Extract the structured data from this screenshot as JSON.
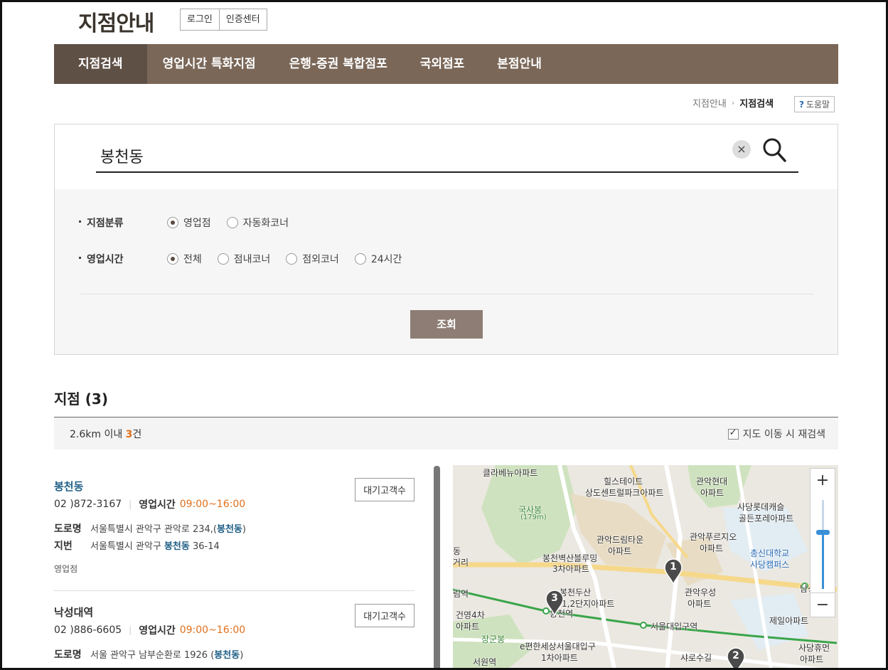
{
  "header": {
    "title": "지점안내",
    "login_label": "로그인",
    "cert_label": "인증센터"
  },
  "nav": {
    "items": [
      "지점검색",
      "영업시간 특화지점",
      "은행-증권 복합점포",
      "국외점포",
      "본점안내"
    ]
  },
  "breadcrumb": {
    "parent": "지점안내",
    "current": "지점검색",
    "help_q": "?",
    "help_label": "도움말"
  },
  "search": {
    "value": "봉천동",
    "clear_symbol": "×"
  },
  "filters": {
    "type_label": "지점분류",
    "type_options": [
      "영업점",
      "자동화코너"
    ],
    "type_selected": "영업점",
    "hours_label": "영업시간",
    "hours_options": [
      "전체",
      "점내코너",
      "점외코너",
      "24시간"
    ],
    "hours_selected": "전체",
    "submit_label": "조회"
  },
  "results": {
    "title": "지점 (3)",
    "radius": "2.6km 이내 ",
    "count": "3",
    "count_suffix": "건",
    "map_research_label": "지도 이동 시 재검색",
    "map_research_checked": true,
    "branches": [
      {
        "name": "봉천동",
        "phone": "02 )872-3167",
        "hours_label": "영업시간",
        "hours": "09:00~16:00",
        "road_label": "도로명",
        "road_addr": "서울특별시 관악구 관악로 234,(",
        "road_kw": "봉천동",
        "road_end": ")",
        "lot_label": "지번",
        "lot_addr": "서울특별시 관악구 ",
        "lot_kw": "봉천동",
        "lot_end": " 36-14",
        "type": "영업점",
        "wait_label": "대기고객수"
      },
      {
        "name": "낙성대역",
        "phone": "02 )886-6605",
        "hours_label": "영업시간",
        "hours": "09:00~16:00",
        "road_label": "도로명",
        "road_addr": "서울 관악구 남부순환로 1926 (",
        "road_kw": "봉천동",
        "road_end": ")",
        "wait_label": "대기고객수"
      }
    ]
  },
  "map": {
    "zoom_in": "+",
    "zoom_out": "−",
    "labels": [
      "클라베뉴아파트",
      "힐스테이트",
      "상도센트럴파크아파트",
      "관악현대",
      "아파트",
      "국사봉",
      "(179m)",
      "사당롯데캐슬",
      "골든포레아파트",
      "관악드림타운",
      "아파트",
      "관악푸르지오",
      "아파트",
      "총신대학교",
      "사당캠퍼스",
      "봉천벽산블루밍",
      "3차아파트",
      "봉천두산",
      "1,2단지아파트",
      "관악우성",
      "아파트",
      "봉천역",
      "서울대입구역",
      "건영4차",
      "아파트",
      "장군봉",
      "제일아파트",
      "e편한세상서울대입구",
      "1차아파트",
      "샤로수길",
      "사당휴먼",
      "아파트",
      "서원역",
      "동",
      "거리",
      "림역",
      "남성역"
    ],
    "markers": [
      "1",
      "2",
      "3"
    ]
  }
}
